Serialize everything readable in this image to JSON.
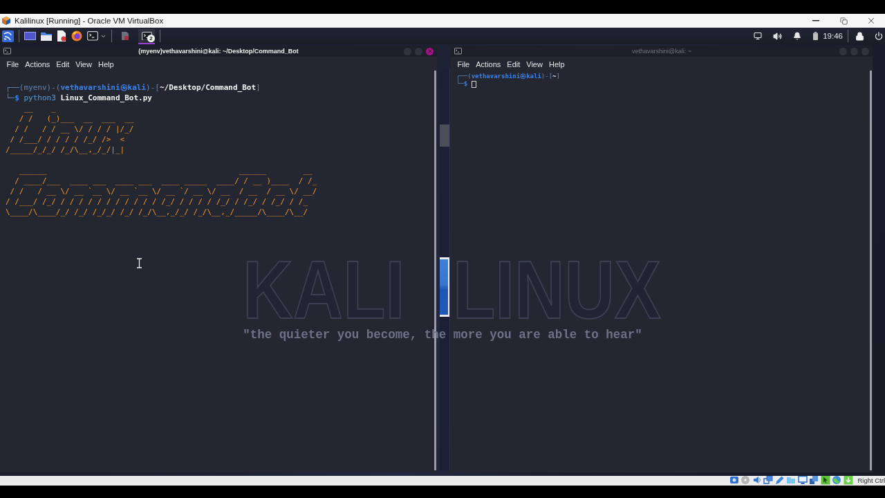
{
  "window": {
    "title": "Kalilinux [Running] - Oracle VM VirtualBox"
  },
  "panel": {
    "tasks": [
      {
        "kind": "document",
        "selected": false
      },
      {
        "kind": "terminal",
        "badge": "2",
        "selected": true
      }
    ],
    "clock": "19:46"
  },
  "wallpaper": {
    "title": [
      "KALI",
      "LINUX"
    ],
    "motto": "\"the quieter you become, the more you are able to hear\""
  },
  "terminals": [
    {
      "title": "(myenv)vethavarshini@kali: ~/Desktop/Command_Bot",
      "focused": true,
      "menu": [
        "File",
        "Actions",
        "Edit",
        "View",
        "Help"
      ],
      "prompt": [
        [
          {
            "text": "┌──(myenv)-(",
            "kind": "frame"
          },
          {
            "text": "vethavarshini㉿kali",
            "kind": "user"
          },
          {
            "text": ")-[",
            "kind": "frame"
          },
          {
            "text": "~/Desktop/Command_Bot",
            "kind": "path"
          },
          {
            "text": "]",
            "kind": "frame"
          }
        ],
        [
          {
            "text": "└─",
            "kind": "frame"
          },
          {
            "text": "$",
            "kind": "sign"
          },
          {
            "text": " python3",
            "kind": "command"
          },
          {
            "text": " Linux_Command_Bot.py",
            "kind": "argument"
          }
        ]
      ],
      "banners": [
        [
          "    __    _",
          "   / /   (_)___  __  ___  __",
          "  / /   / / __ \\/ / / / |/_/",
          " / /___/ / / / / /_/ />  <",
          "/_____/_/_/ /_/\\__,_/_/|_|"
        ],
        [
          "   ______                                          ______        __",
          "  / ____/___  ____ ___  ____ ___  ____ _____  ____/ / __ )____  / /_",
          " / /   / __ \\/ __ `__ \\/ __ `__ \\/ __ `/ __ \\/ __  / __  / __ \\/ __/",
          "/ /___/ /_/ / / / / / / / / / / / /_/ / / / / /_/ / /_/ / /_/ / /_",
          "\\____/\\____/_/ /_/ /_/_/ /_/ /_/\\__,_/_/ /_/\\__,_/_____/\\____/\\__/"
        ]
      ],
      "cursor": false
    },
    {
      "title": "vethavarshini@kali: ~",
      "focused": false,
      "menu": [
        "File",
        "Actions",
        "Edit",
        "View",
        "Help"
      ],
      "prompt": [
        [
          {
            "text": "┌──(",
            "kind": "frame"
          },
          {
            "text": "vethavarshini㉿kali",
            "kind": "user"
          },
          {
            "text": ")-[",
            "kind": "frame"
          },
          {
            "text": "~",
            "kind": "path"
          },
          {
            "text": "]",
            "kind": "frame"
          }
        ],
        [
          {
            "text": "└─",
            "kind": "frame"
          },
          {
            "text": "$ ",
            "kind": "sign"
          }
        ]
      ],
      "cursor": true
    }
  ],
  "status_bar": {
    "host_key": "Right Ctrl"
  }
}
